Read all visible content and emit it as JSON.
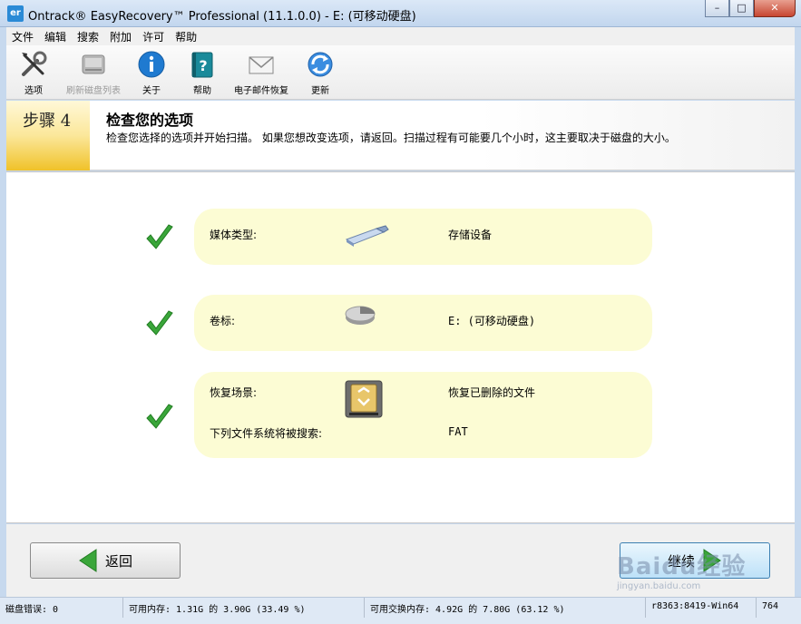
{
  "window": {
    "app_icon": "er",
    "title": "Ontrack® EasyRecovery™ Professional (11.1.0.0) - E: (可移动硬盘)",
    "minimize": "–",
    "maximize": "□",
    "close": "✕"
  },
  "menu": [
    "文件",
    "编辑",
    "搜索",
    "附加",
    "许可",
    "帮助"
  ],
  "toolbar": {
    "options": "选项",
    "refresh": "刷新磁盘列表",
    "about": "关于",
    "help": "帮助",
    "email_recovery": "电子邮件恢复",
    "update": "更新"
  },
  "step": {
    "badge": "步骤 4",
    "title": "检查您的选项",
    "description": "检查您选择的选项并开始扫描。 如果您想改变选项，请返回。扫描过程有可能要几个小时，这主要取决于磁盘的大小。"
  },
  "summary": {
    "media_label": "媒体类型:",
    "media_value": "存储设备",
    "volume_label": "卷标:",
    "volume_value": "E: (可移动硬盘)",
    "scenario_label": "恢复场景:",
    "scenario_value": "恢复已删除的文件",
    "fs_label": "下列文件系统将被搜索:",
    "fs_value": "FAT"
  },
  "nav": {
    "back": "返回",
    "next": "继续"
  },
  "status": {
    "disk_errors": "磁盘错误: 0",
    "memory": "可用内存: 1.31G 的 3.90G (33.49 %)",
    "swap": "可用交换内存: 4.92G 的 7.80G (63.12 %)",
    "build": "r8363:8419-Win64",
    "num": "764"
  },
  "watermark": {
    "brand": "Baidu经验",
    "url": "jingyan.baidu.com"
  },
  "colors": {
    "card_bg": "#fcfcd4",
    "badge_yellow": "#f0c229",
    "check_green": "#3aa63a"
  }
}
